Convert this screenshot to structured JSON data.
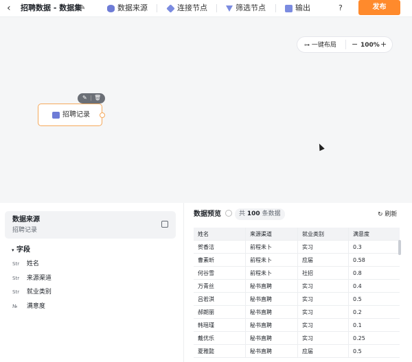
{
  "toolbar": {
    "back_icon": "chevron-left-icon",
    "title": "招聘数据 - 数据集",
    "edit_icon": "pencil-icon",
    "tools": [
      {
        "label": "数据来源",
        "icon": "database-icon",
        "color": "#6e7cd6"
      },
      {
        "label": "连接节点",
        "icon": "link-icon",
        "color": "#7b8be0"
      },
      {
        "label": "筛选节点",
        "icon": "filter-icon",
        "color": "#7b8be0"
      },
      {
        "label": "输出",
        "icon": "export-icon",
        "color": "#7b8be0"
      }
    ],
    "help": "?",
    "publish": "发布",
    "publish_color": "#ff8a2c"
  },
  "canvas": {
    "auto_layout": "一键布局",
    "zoom": "100%",
    "node": {
      "label": "招聘记录",
      "accent": "#f5a85a"
    }
  },
  "source_panel": {
    "title": "数据来源",
    "subtitle": "招聘记录",
    "fields_heading": "字段",
    "fields": [
      {
        "type": "Str",
        "name": "姓名"
      },
      {
        "type": "Str",
        "name": "来源渠道"
      },
      {
        "type": "Str",
        "name": "就业类别"
      },
      {
        "type": "№",
        "name": "满意度"
      }
    ]
  },
  "preview": {
    "title": "数据预览",
    "count_prefix": "共",
    "count": "100",
    "count_suffix": "条数据",
    "refresh": "刷新",
    "columns": [
      "姓名",
      "来源渠道",
      "就业类别",
      "满意度"
    ],
    "rows": [
      [
        "贺香洁",
        "前程未卜",
        "实习",
        "0.3"
      ],
      [
        "曹素昕",
        "前程未卜",
        "应届",
        "0.58"
      ],
      [
        "何谷雪",
        "前程未卜",
        "社招",
        "0.8"
      ],
      [
        "万青丝",
        "秘书直聘",
        "实习",
        "0.4"
      ],
      [
        "吕若淇",
        "秘书直聘",
        "实习",
        "0.5"
      ],
      [
        "郝朗丽",
        "秘书直聘",
        "实习",
        "0.2"
      ],
      [
        "韩瑶瑾",
        "秘书直聘",
        "实习",
        "0.1"
      ],
      [
        "戴优乐",
        "秘书直聘",
        "实习",
        "0.25"
      ],
      [
        "夏雅懿",
        "秘书直聘",
        "应届",
        "0.5"
      ]
    ]
  }
}
